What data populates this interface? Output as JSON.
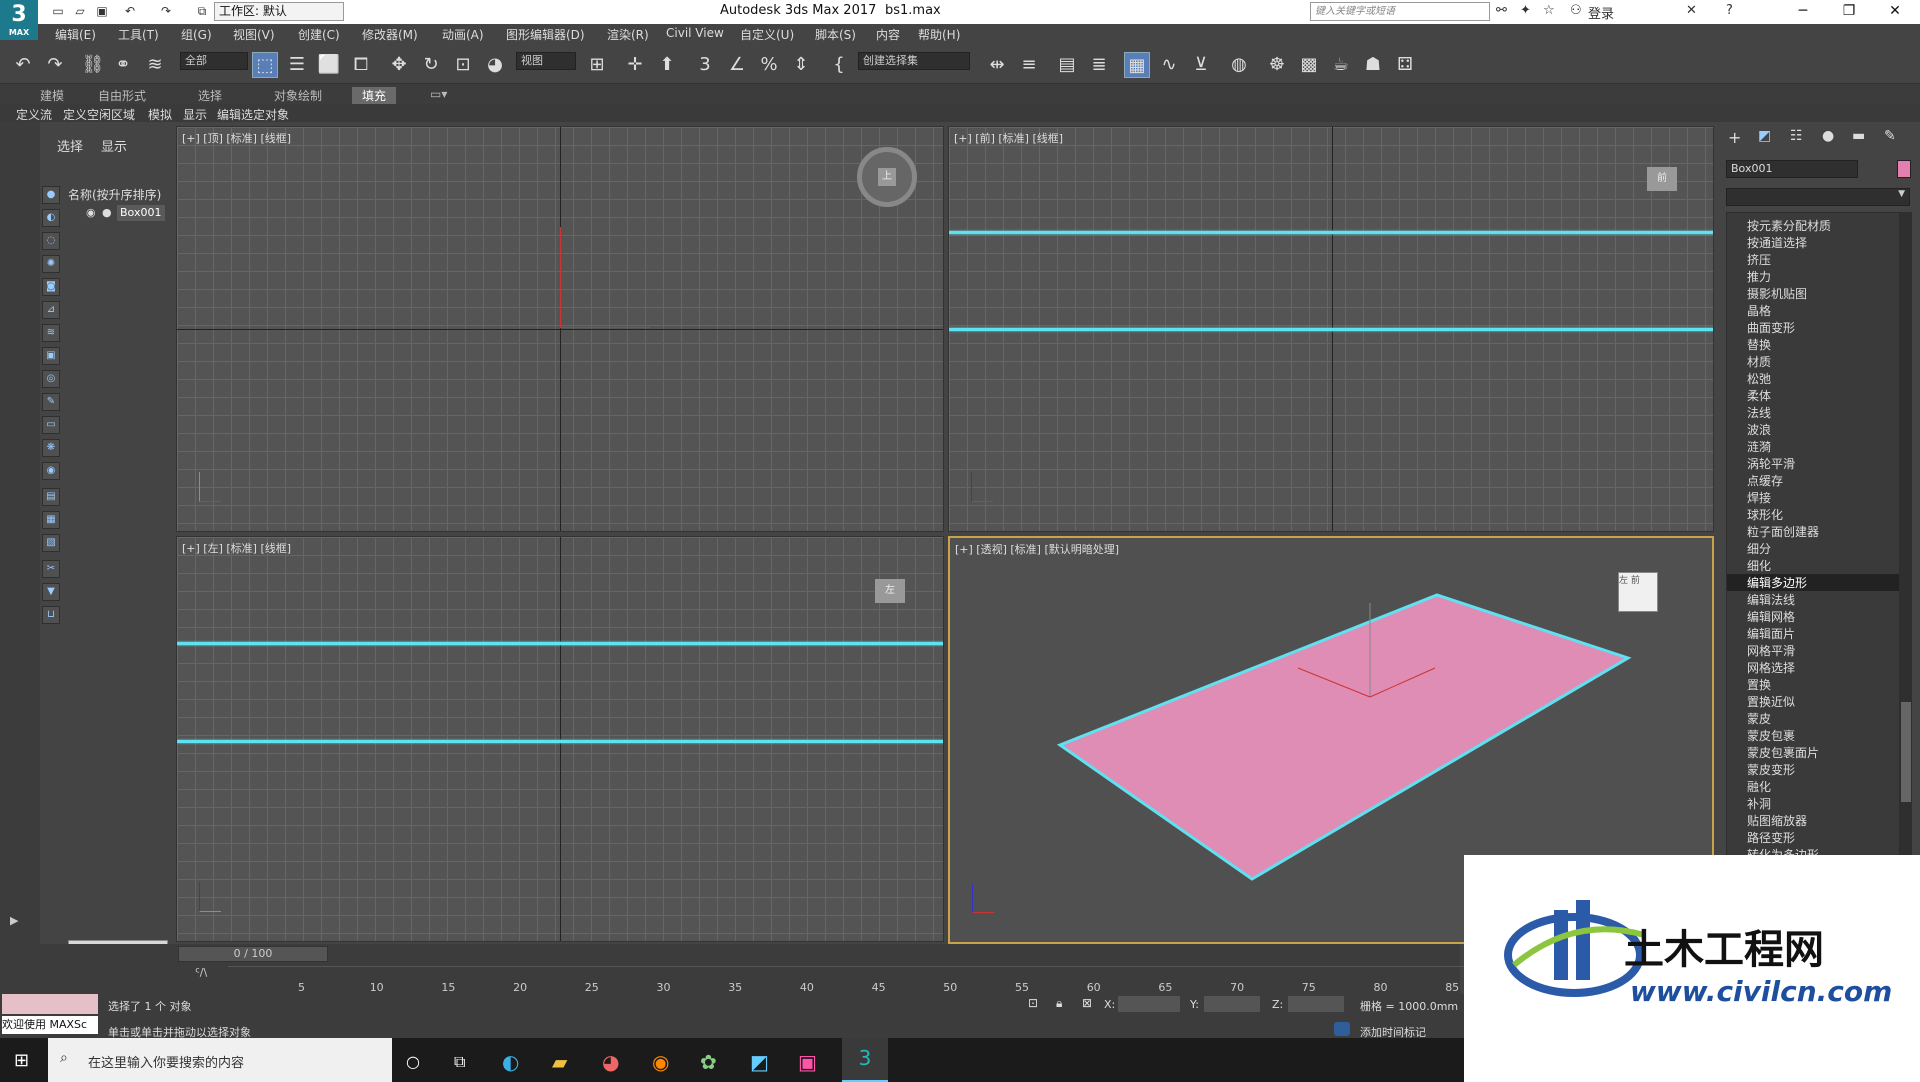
{
  "title_bar": {
    "logo": "3",
    "logo_sub": "MAX",
    "workspace": "工作区: 默认",
    "app_title": "Autodesk 3ds Max 2017",
    "file_name": "bs1.max",
    "search_placeholder": "键入关键字或短语",
    "login": "登录"
  },
  "menu": [
    "编辑(E)",
    "工具(T)",
    "组(G)",
    "视图(V)",
    "创建(C)",
    "修改器(M)",
    "动画(A)",
    "图形编辑器(D)",
    "渲染(R)",
    "Civil View",
    "自定义(U)",
    "脚本(S)",
    "内容",
    "帮助(H)"
  ],
  "toolbar": {
    "filter": "全部",
    "ref_coord": "视图",
    "selection_set": "创建选择集"
  },
  "ribbon_tabs": [
    "建模",
    "自由形式",
    "选择",
    "对象绘制",
    "填充"
  ],
  "ribbon_sub": [
    "定义流",
    "定义空闲区域",
    "模拟",
    "显示",
    "编辑选定对象"
  ],
  "scene_explorer": {
    "tab_select": "选择",
    "tab_display": "显示",
    "header": "名称(按升序排序)",
    "item": "Box001"
  },
  "viewports": {
    "top": "[+] [顶] [标准] [线框]",
    "front": "[+] [前] [标准] [线框]",
    "left": "[+] [左] [标准] [线框]",
    "perspective": "[+] [透视] [标准] [默认明暗处理]"
  },
  "viewcube": {
    "top": "上",
    "front": "前",
    "left": "左",
    "perspective_face_a": "左",
    "perspective_face_b": "前"
  },
  "command_panel": {
    "object_name": "Box001",
    "object_color": "#e57fb0",
    "modifiers": [
      "按元素分配材质",
      "按通道选择",
      "挤压",
      "推力",
      "摄影机贴图",
      "晶格",
      "曲面变形",
      "替换",
      "材质",
      "松弛",
      "柔体",
      "法线",
      "波浪",
      "涟漪",
      "涡轮平滑",
      "点缓存",
      "焊接",
      "球形化",
      "粒子面创建器",
      "细分",
      "细化",
      "编辑多边形",
      "编辑法线",
      "编辑网格",
      "编辑面片",
      "网格平滑",
      "网格选择",
      "置换",
      "置换近似",
      "蒙皮",
      "蒙皮包裹",
      "蒙皮包裹面片",
      "蒙皮变形",
      "融化",
      "补洞",
      "贴图缩放器",
      "路径变形",
      "转化为多边形"
    ],
    "selected_modifier": "编辑多边形"
  },
  "timeline": {
    "frame": "0 / 100",
    "ticks": [
      "5",
      "10",
      "15",
      "20",
      "25",
      "30",
      "35",
      "40",
      "45",
      "50",
      "55",
      "60",
      "65",
      "70",
      "75",
      "80",
      "85"
    ]
  },
  "status": {
    "welcome": "欢迎使用 MAXSc",
    "selected": "选择了 1 个 对象",
    "hint": "单击或单击并拖动以选择对象",
    "x_label": "X:",
    "y_label": "Y:",
    "z_label": "Z:",
    "grid": "栅格 = 1000.0mm",
    "add_time_tag": "添加时间标记"
  },
  "taskbar": {
    "search_placeholder": "在这里输入你要搜索的内容"
  },
  "watermark": {
    "title": "土木工程网",
    "url": "www.civilcn.com"
  }
}
